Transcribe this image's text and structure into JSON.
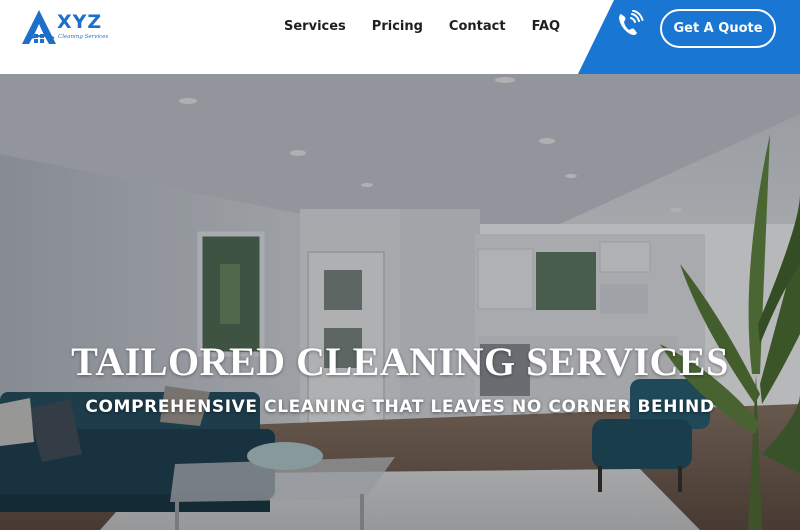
{
  "brand": {
    "name": "XYZ",
    "tagline": "Cleaning Services",
    "color": "#1d6fc8"
  },
  "nav": {
    "items": [
      {
        "label": "Services"
      },
      {
        "label": "Pricing"
      },
      {
        "label": "Contact"
      },
      {
        "label": "FAQ"
      }
    ]
  },
  "header_cta": {
    "quote_label": "Get A Quote",
    "phone_icon": "phone-ringing-icon",
    "band_color": "#1976d2"
  },
  "hero": {
    "title": "TAILORED CLEANING SERVICES",
    "subtitle": "COMPREHENSIVE CLEANING THAT LEAVES NO CORNER BEHIND"
  }
}
